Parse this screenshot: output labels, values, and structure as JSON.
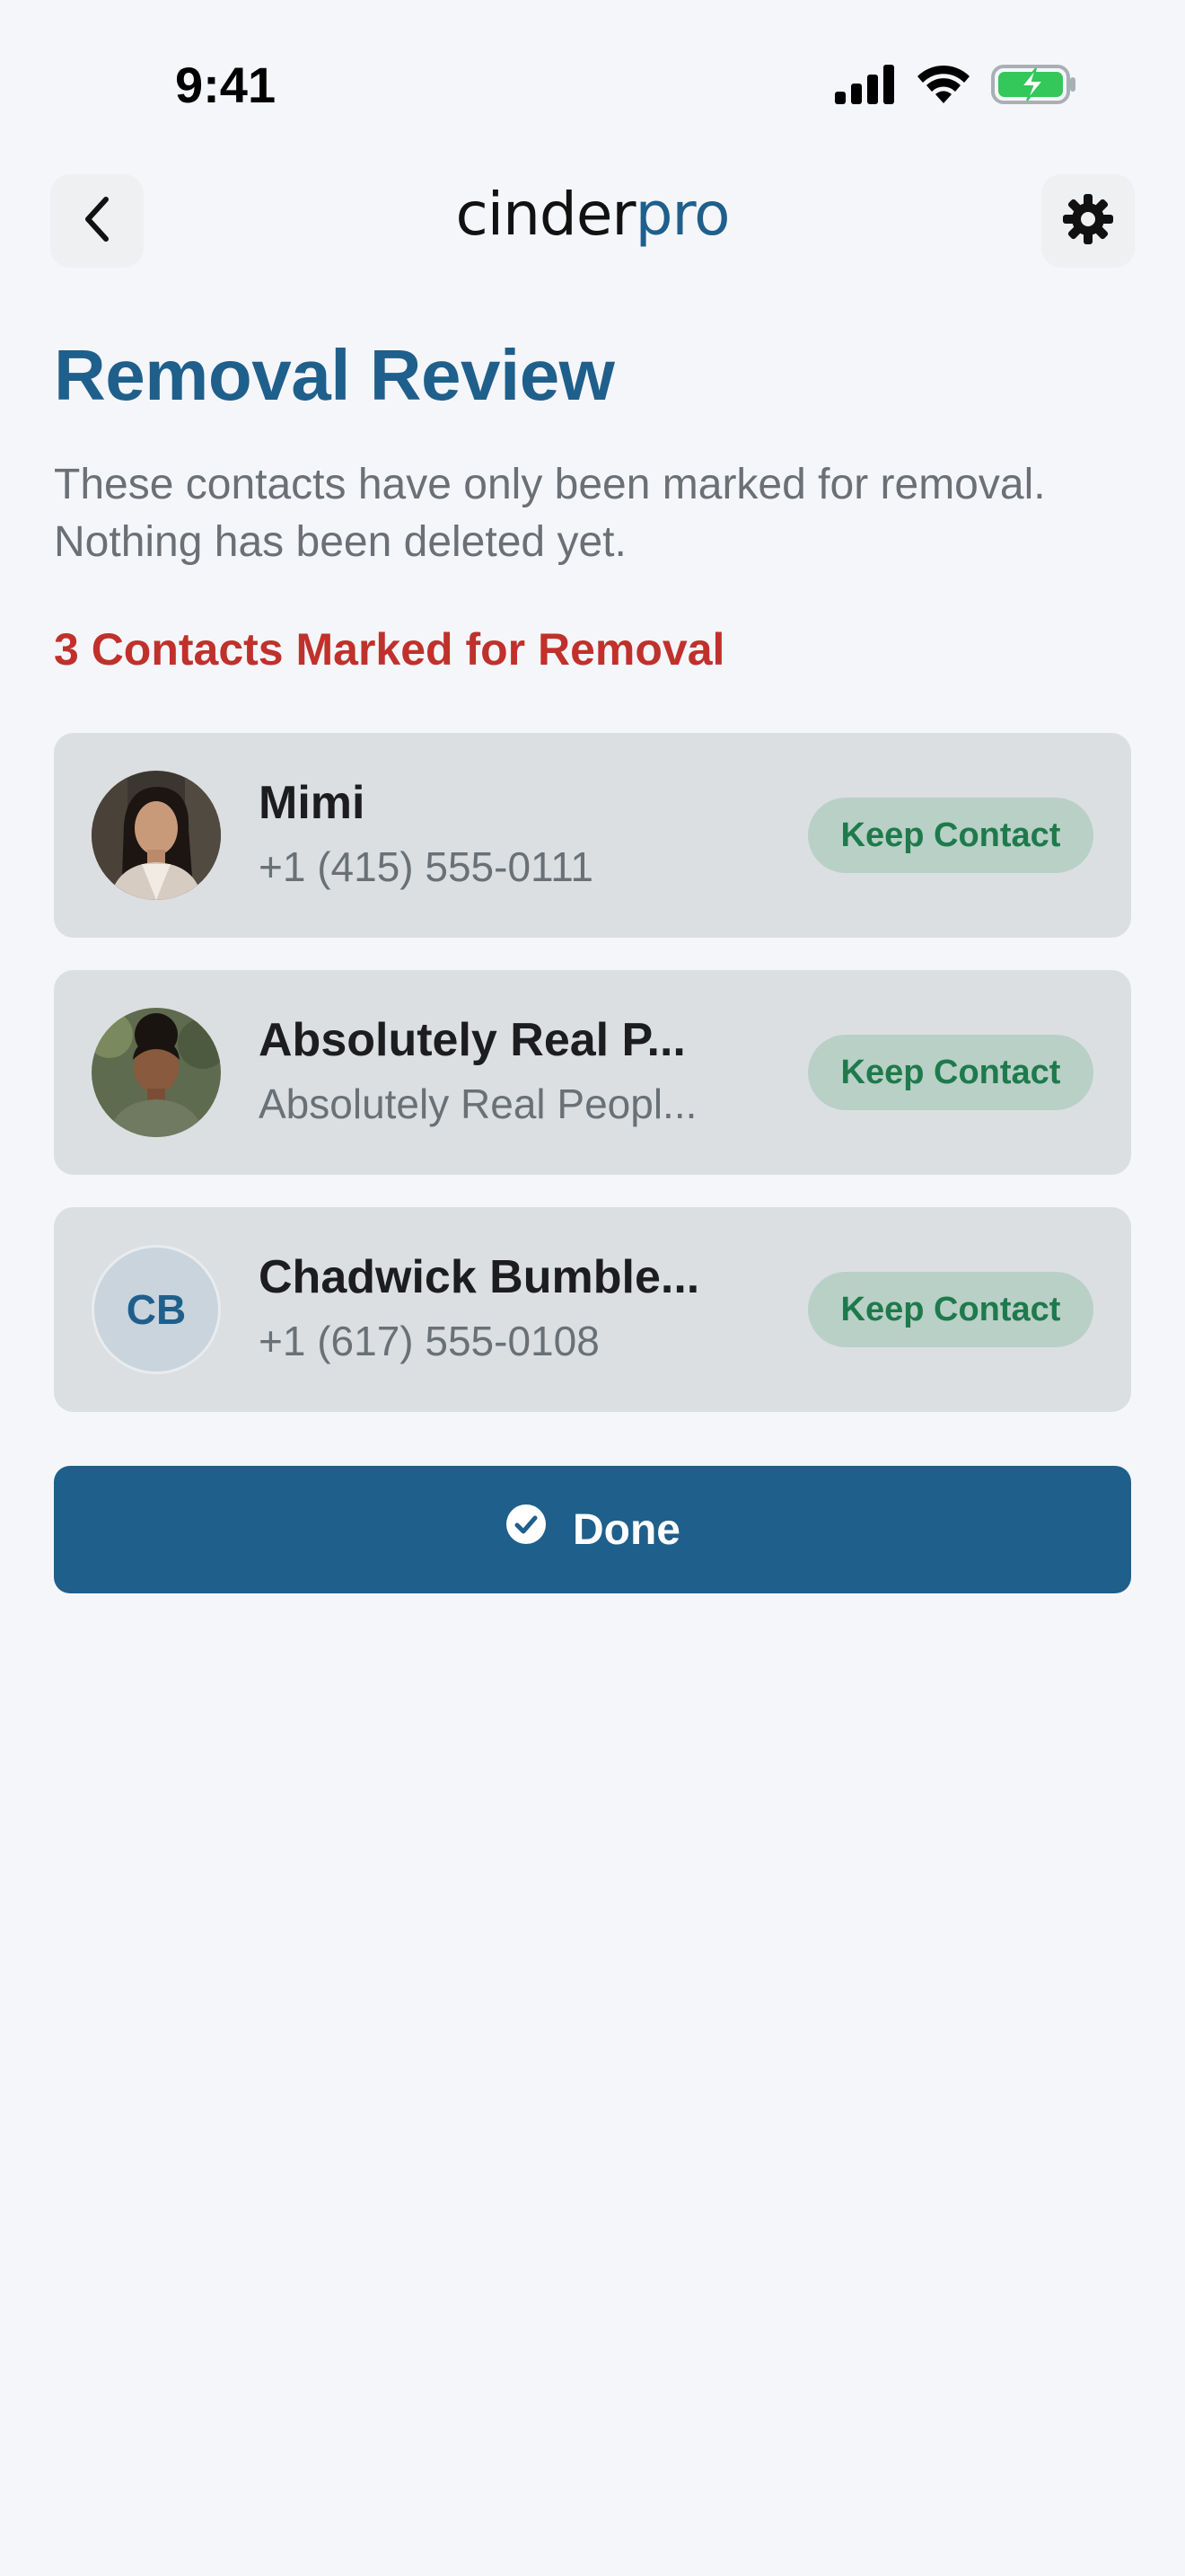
{
  "status_bar": {
    "time": "9:41",
    "icons": [
      "signal-icon",
      "wifi-icon",
      "battery-charging-icon"
    ]
  },
  "nav": {
    "back_icon": "chevron-left-icon",
    "logo_part1": "cinder",
    "logo_part2": "pro",
    "settings_icon": "gear-icon"
  },
  "page": {
    "title": "Removal Review",
    "subtitle": "These contacts have only been marked for removal. Nothing has been deleted yet.",
    "count_label": "3 Contacts Marked for Removal"
  },
  "contacts": [
    {
      "name": "Mimi",
      "detail": "+1 (415) 555-0111",
      "avatar": "photo",
      "action": "Keep Contact"
    },
    {
      "name": "Absolutely Real P...",
      "detail": "Absolutely Real Peopl...",
      "avatar": "photo",
      "action": "Keep Contact"
    },
    {
      "name": "Chadwick Bumble...",
      "detail": "+1 (617) 555-0108",
      "avatar": "initials",
      "initials": "CB",
      "action": "Keep Contact"
    }
  ],
  "done_button": {
    "label": "Done",
    "icon": "check-circle-icon"
  },
  "colors": {
    "background": "#f5f6fa",
    "brand": "#1f5f8b",
    "danger": "#c0312b",
    "keep_bg": "#b9d0c6",
    "keep_text": "#1e7a4c",
    "card_bg": "#dcdfe1"
  }
}
